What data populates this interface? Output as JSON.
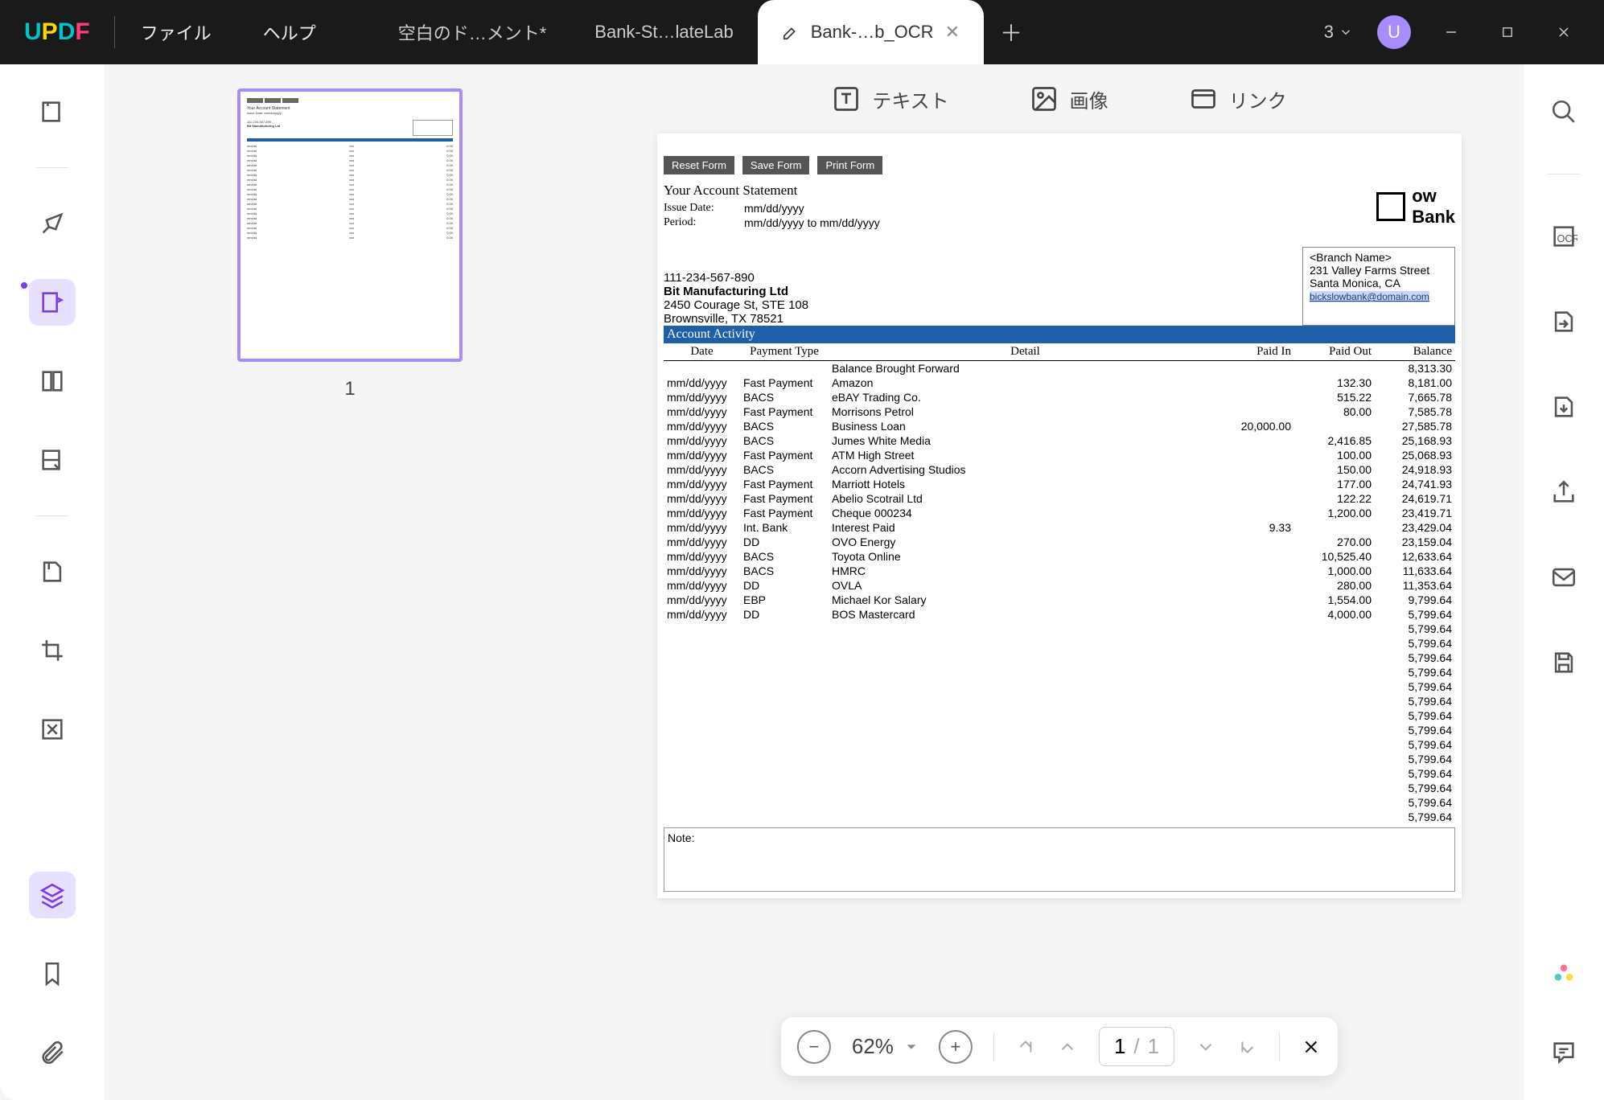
{
  "titlebar": {
    "logo": "UPDF",
    "menu_file": "ファイル",
    "menu_help": "ヘルプ",
    "tabs": [
      {
        "label": "空白のド…メント*"
      },
      {
        "label": "Bank-St…lateLab"
      },
      {
        "label": "Bank-…b_OCR"
      }
    ],
    "add": "＋",
    "count": "3",
    "avatar": "U"
  },
  "edit_tools": {
    "text": "テキスト",
    "image": "画像",
    "link": "リンク"
  },
  "thumb": {
    "page_num": "1"
  },
  "doc": {
    "form_buttons": {
      "reset": "Reset Form",
      "save": "Save Form",
      "print": "Print Form"
    },
    "stmt_title": "Your Account Statement",
    "issue_label": "Issue Date:",
    "issue_value": "mm/dd/yyyy",
    "period_label": "Period:",
    "period_value": "mm/dd/yyyy to mm/dd/yyyy",
    "bank_name_top": "ow",
    "bank_name_bot": "Bank",
    "acct_num": "111-234-567-890",
    "company": "Bit Manufacturing Ltd",
    "addr1": "2450 Courage St, STE 108",
    "addr2": "Brownsville, TX 78521",
    "branch": "<Branch Name>",
    "baddr1": "231 Valley Farms Street",
    "baddr2": "Santa Monica, CA",
    "bemail": "bickslowbank@domain.com",
    "activity_hdr": "Account Activity",
    "cols": {
      "date": "Date",
      "ptype": "Payment Type",
      "detail": "Detail",
      "paidin": "Paid In",
      "paidout": "Paid Out",
      "balance": "Balance"
    },
    "note_label": "Note:"
  },
  "rows": [
    {
      "date": "",
      "ptype": "",
      "detail": "Balance Brought Forward",
      "pin": "",
      "pout": "",
      "bal": "8,313.30"
    },
    {
      "date": "mm/dd/yyyy",
      "ptype": "Fast Payment",
      "detail": "Amazon",
      "pin": "",
      "pout": "132.30",
      "bal": "8,181.00"
    },
    {
      "date": "mm/dd/yyyy",
      "ptype": "BACS",
      "detail": "eBAY Trading Co.",
      "pin": "",
      "pout": "515.22",
      "bal": "7,665.78"
    },
    {
      "date": "mm/dd/yyyy",
      "ptype": "Fast Payment",
      "detail": "Morrisons Petrol",
      "pin": "",
      "pout": "80.00",
      "bal": "7,585.78"
    },
    {
      "date": "mm/dd/yyyy",
      "ptype": "BACS",
      "detail": "Business Loan",
      "pin": "20,000.00",
      "pout": "",
      "bal": "27,585.78"
    },
    {
      "date": "mm/dd/yyyy",
      "ptype": "BACS",
      "detail": "Jumes White Media",
      "pin": "",
      "pout": "2,416.85",
      "bal": "25,168.93"
    },
    {
      "date": "mm/dd/yyyy",
      "ptype": "Fast Payment",
      "detail": "ATM High Street",
      "pin": "",
      "pout": "100.00",
      "bal": "25,068.93"
    },
    {
      "date": "mm/dd/yyyy",
      "ptype": "BACS",
      "detail": "Accorn Advertising Studios",
      "pin": "",
      "pout": "150.00",
      "bal": "24,918.93"
    },
    {
      "date": "mm/dd/yyyy",
      "ptype": "Fast Payment",
      "detail": "Marriott Hotels",
      "pin": "",
      "pout": "177.00",
      "bal": "24,741.93"
    },
    {
      "date": "mm/dd/yyyy",
      "ptype": "Fast Payment",
      "detail": "Abelio Scotrail Ltd",
      "pin": "",
      "pout": "122.22",
      "bal": "24,619.71"
    },
    {
      "date": "mm/dd/yyyy",
      "ptype": "Fast Payment",
      "detail": "Cheque 000234",
      "pin": "",
      "pout": "1,200.00",
      "bal": "23,419.71"
    },
    {
      "date": "mm/dd/yyyy",
      "ptype": "Int. Bank",
      "detail": "Interest Paid",
      "pin": "9.33",
      "pout": "",
      "bal": "23,429.04"
    },
    {
      "date": "mm/dd/yyyy",
      "ptype": "DD",
      "detail": "OVO Energy",
      "pin": "",
      "pout": "270.00",
      "bal": "23,159.04"
    },
    {
      "date": "mm/dd/yyyy",
      "ptype": "BACS",
      "detail": "Toyota Online",
      "pin": "",
      "pout": "10,525.40",
      "bal": "12,633.64"
    },
    {
      "date": "mm/dd/yyyy",
      "ptype": "BACS",
      "detail": "HMRC",
      "pin": "",
      "pout": "1,000.00",
      "bal": "11,633.64"
    },
    {
      "date": "mm/dd/yyyy",
      "ptype": "DD",
      "detail": "OVLA",
      "pin": "",
      "pout": "280.00",
      "bal": "11,353.64"
    },
    {
      "date": "mm/dd/yyyy",
      "ptype": "EBP",
      "detail": "Michael Kor Salary",
      "pin": "",
      "pout": "1,554.00",
      "bal": "9,799.64"
    },
    {
      "date": "mm/dd/yyyy",
      "ptype": "DD",
      "detail": "BOS Mastercard",
      "pin": "",
      "pout": "4,000.00",
      "bal": "5,799.64"
    },
    {
      "date": "",
      "ptype": "",
      "detail": "",
      "pin": "",
      "pout": "",
      "bal": "5,799.64"
    },
    {
      "date": "",
      "ptype": "",
      "detail": "",
      "pin": "",
      "pout": "",
      "bal": "5,799.64"
    },
    {
      "date": "",
      "ptype": "",
      "detail": "",
      "pin": "",
      "pout": "",
      "bal": "5,799.64"
    },
    {
      "date": "",
      "ptype": "",
      "detail": "",
      "pin": "",
      "pout": "",
      "bal": "5,799.64"
    },
    {
      "date": "",
      "ptype": "",
      "detail": "",
      "pin": "",
      "pout": "",
      "bal": "5,799.64"
    },
    {
      "date": "",
      "ptype": "",
      "detail": "",
      "pin": "",
      "pout": "",
      "bal": "5,799.64"
    },
    {
      "date": "",
      "ptype": "",
      "detail": "",
      "pin": "",
      "pout": "",
      "bal": "5,799.64"
    },
    {
      "date": "",
      "ptype": "",
      "detail": "",
      "pin": "",
      "pout": "",
      "bal": "5,799.64"
    },
    {
      "date": "",
      "ptype": "",
      "detail": "",
      "pin": "",
      "pout": "",
      "bal": "5,799.64"
    },
    {
      "date": "",
      "ptype": "",
      "detail": "",
      "pin": "",
      "pout": "",
      "bal": "5,799.64"
    },
    {
      "date": "",
      "ptype": "",
      "detail": "",
      "pin": "",
      "pout": "",
      "bal": "5,799.64"
    },
    {
      "date": "",
      "ptype": "",
      "detail": "",
      "pin": "",
      "pout": "",
      "bal": "5,799.64"
    },
    {
      "date": "",
      "ptype": "",
      "detail": "",
      "pin": "",
      "pout": "",
      "bal": "5,799.64"
    },
    {
      "date": "",
      "ptype": "",
      "detail": "",
      "pin": "",
      "pout": "",
      "bal": "5,799.64"
    }
  ],
  "zoom": {
    "pct": "62%",
    "page": "1",
    "sep": "/",
    "total": "1"
  }
}
